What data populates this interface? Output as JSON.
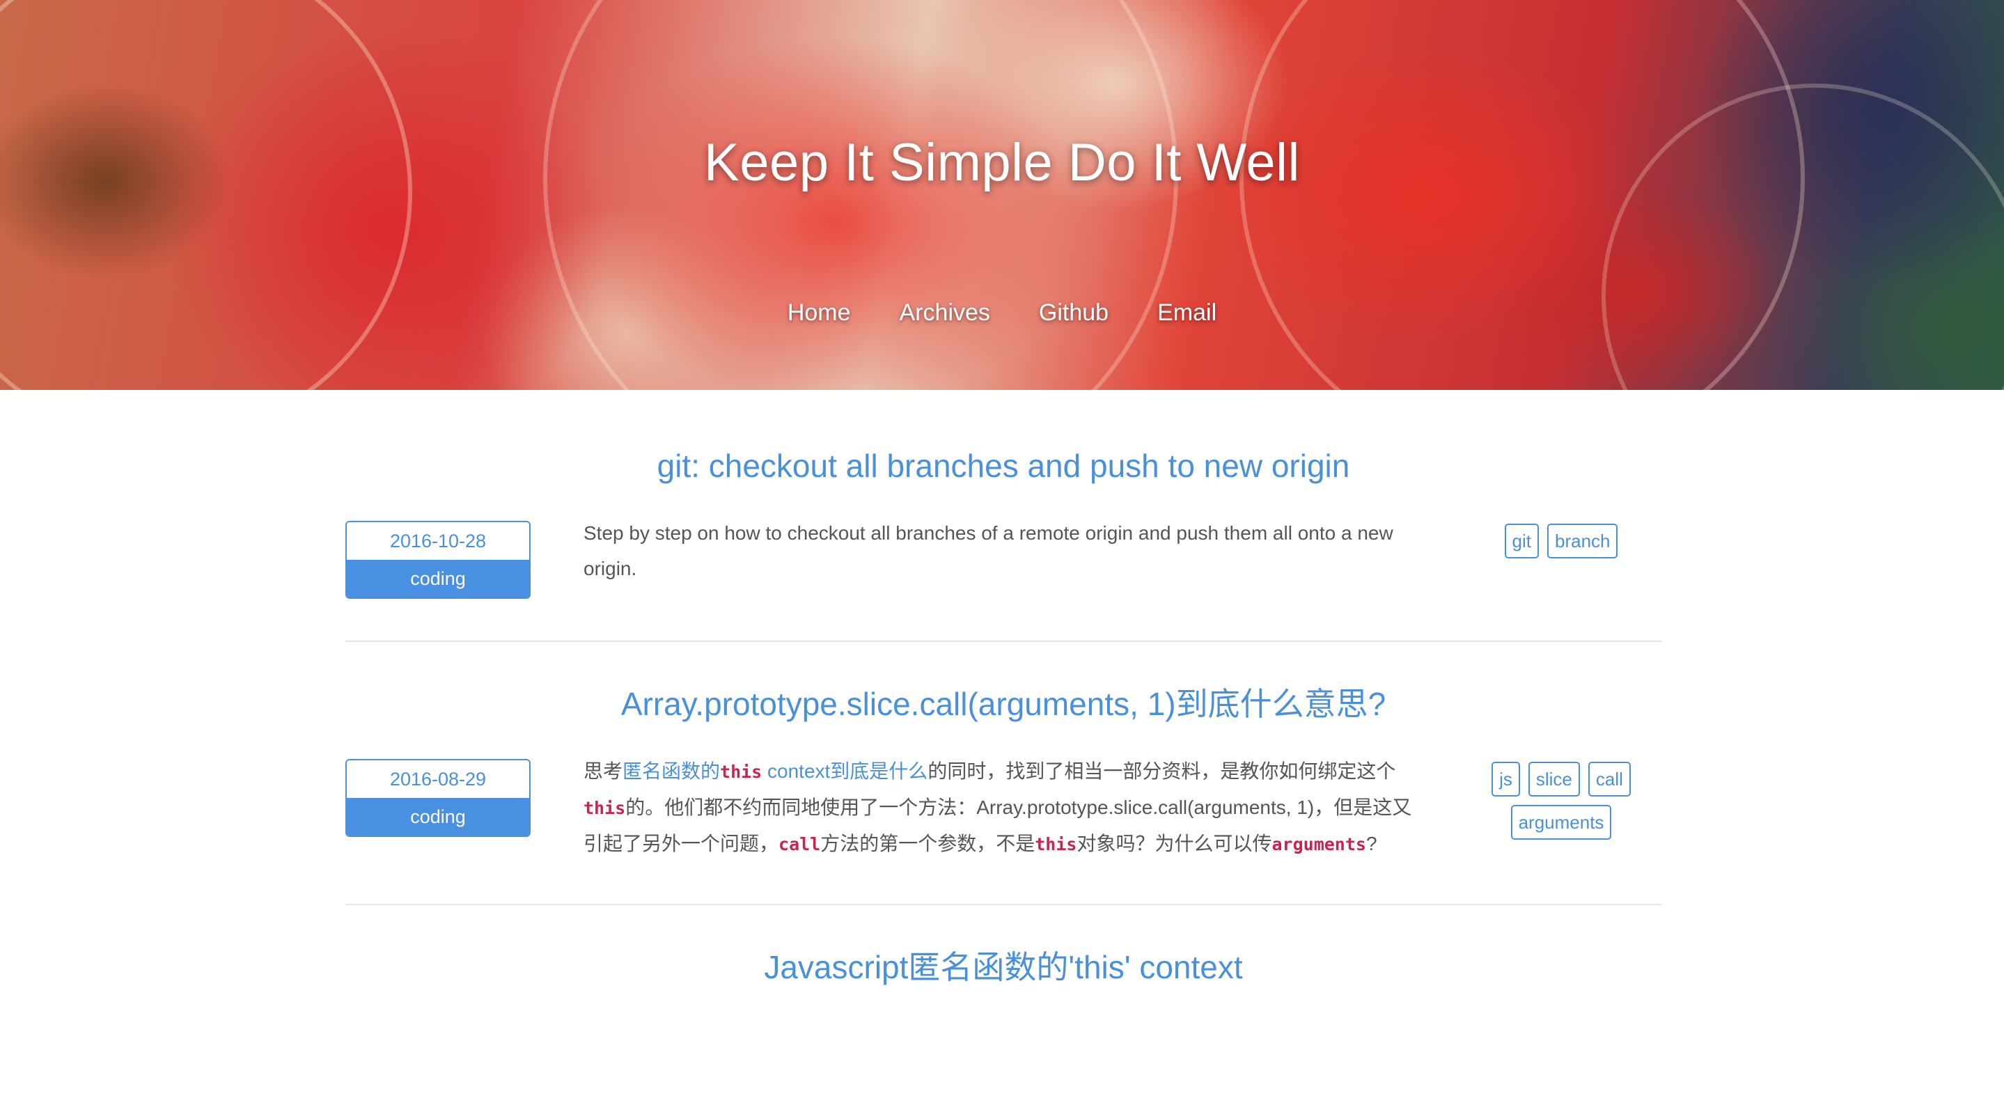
{
  "site": {
    "title": "Keep It Simple Do It Well",
    "nav": [
      {
        "label": "Home"
      },
      {
        "label": "Archives"
      },
      {
        "label": "Github"
      },
      {
        "label": "Email"
      }
    ]
  },
  "colors": {
    "accent": "#4a90d9",
    "category_bg": "#4a90e2",
    "code": "#c7254e",
    "text": "#555555"
  },
  "posts": [
    {
      "title": "git: checkout all branches and push to new origin",
      "date": "2016-10-28",
      "category": "coding",
      "excerpt": "Step by step on how to checkout all branches of a remote origin and push them all onto a new origin.",
      "tags": [
        "git",
        "branch"
      ]
    },
    {
      "title": "Array.prototype.slice.call(arguments, 1)到底什么意思?",
      "date": "2016-08-29",
      "category": "coding",
      "excerpt_parts": {
        "p1": "思考",
        "link": "匿名函数的",
        "code_this_1": "this",
        "link2": " context到底是什么",
        "p2": "的同时，找到了相当一部分资料，是教你如何绑定这个",
        "code_this_2": "this",
        "p3": "的。他们都不约而同地使用了一个方法：Array.prototype.slice.call(arguments, 1)，但是这又引起了另外一个问题，",
        "code_call": "call",
        "p4": "方法的第一个参数，不是",
        "code_this_3": "this",
        "p5": "对象吗？为什么可以传",
        "code_arguments": "arguments",
        "p6": "?"
      },
      "tags": [
        "js",
        "slice",
        "call",
        "arguments"
      ]
    },
    {
      "title": "Javascript匿名函数的'this' context"
    }
  ]
}
